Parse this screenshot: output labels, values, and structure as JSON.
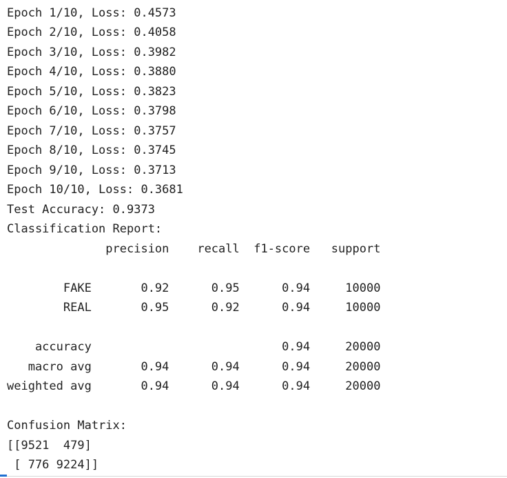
{
  "output": {
    "lines": [
      "Epoch 1/10, Loss: 0.4573",
      "Epoch 2/10, Loss: 0.4058",
      "Epoch 3/10, Loss: 0.3982",
      "Epoch 4/10, Loss: 0.3880",
      "Epoch 5/10, Loss: 0.3823",
      "Epoch 6/10, Loss: 0.3798",
      "Epoch 7/10, Loss: 0.3757",
      "Epoch 8/10, Loss: 0.3745",
      "Epoch 9/10, Loss: 0.3713",
      "Epoch 10/10, Loss: 0.3681",
      "Test Accuracy: 0.9373",
      "Classification Report:",
      "              precision    recall  f1-score   support",
      "",
      "        FAKE       0.92      0.95      0.94     10000",
      "        REAL       0.95      0.92      0.94     10000",
      "",
      "    accuracy                           0.94     20000",
      "   macro avg       0.94      0.94      0.94     20000",
      "weighted avg       0.94      0.94      0.94     20000",
      "",
      "Confusion Matrix:",
      "[[9521  479]",
      " [ 776 9224]]"
    ]
  }
}
